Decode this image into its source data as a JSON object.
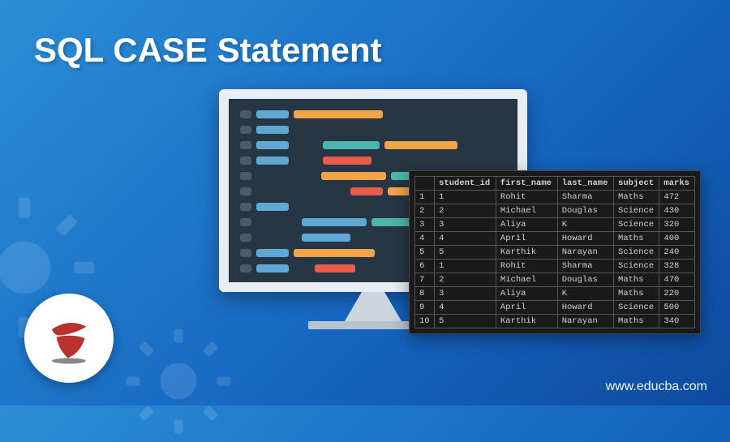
{
  "title": "SQL CASE Statement",
  "website": "www.educba.com",
  "logo_name": "sql-server-logo",
  "table": {
    "headers": [
      "",
      "student_id",
      "first_name",
      "last_name",
      "subject",
      "marks"
    ],
    "rows": [
      [
        "1",
        "1",
        "Rohit",
        "Sharma",
        "Maths",
        "472"
      ],
      [
        "2",
        "2",
        "Michael",
        "Douglas",
        "Science",
        "430"
      ],
      [
        "3",
        "3",
        "Aliya",
        "K",
        "Science",
        "320"
      ],
      [
        "4",
        "4",
        "April",
        "Howard",
        "Maths",
        "400"
      ],
      [
        "5",
        "5",
        "Karthik",
        "Narayan",
        "Science",
        "240"
      ],
      [
        "6",
        "1",
        "Rohit",
        "Sharma",
        "Science",
        "328"
      ],
      [
        "7",
        "2",
        "Michael",
        "Douglas",
        "Maths",
        "470"
      ],
      [
        "8",
        "3",
        "Aliya",
        "K",
        "Maths",
        "220"
      ],
      [
        "9",
        "4",
        "April",
        "Howard",
        "Science",
        "500"
      ],
      [
        "10",
        "5",
        "Karthik",
        "Narayan",
        "Maths",
        "340"
      ]
    ]
  }
}
